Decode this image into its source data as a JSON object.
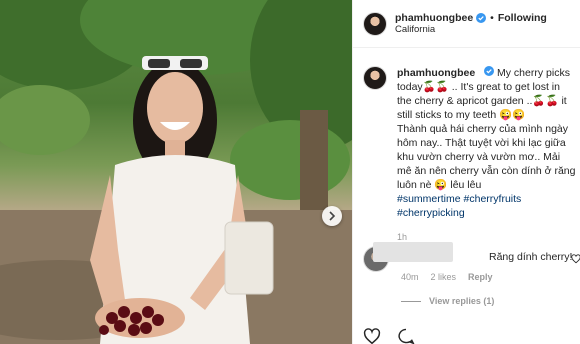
{
  "header": {
    "username": "phamhuongbee",
    "follow_label": "Following",
    "separator": "•",
    "location": "California"
  },
  "caption": {
    "username": "phamhuongbee",
    "text_en": "My cherry picks today🍒🍒 .. It's great to get lost in the cherry & apricot garden ..🍒🍒 it still sticks to my teeth 😜😜",
    "text_vi": "Thành quả hái cherry của mình ngày hôm nay.. Thật tuyệt vời khi lạc giữa khu vườn cherry và vườn mơ.. Mải mê ăn nên cherry vẫn còn dính ở răng luôn nè 😜 lêu lêu",
    "hashtags": [
      "#summertime #cherryfruits",
      "#cherrypicking"
    ],
    "time": "1h"
  },
  "comment": {
    "text": "Răng dính cherry!",
    "time": "40m",
    "likes": "2 likes",
    "reply_label": "Reply",
    "view_replies": "View replies (1)"
  },
  "icons": {
    "verified": "verified-badge-icon",
    "heart": "heart-icon",
    "comment": "comment-icon",
    "next": "chevron-right-icon"
  },
  "colors": {
    "verified": "#3897f0",
    "hashtag": "#003569",
    "muted": "#999999"
  }
}
